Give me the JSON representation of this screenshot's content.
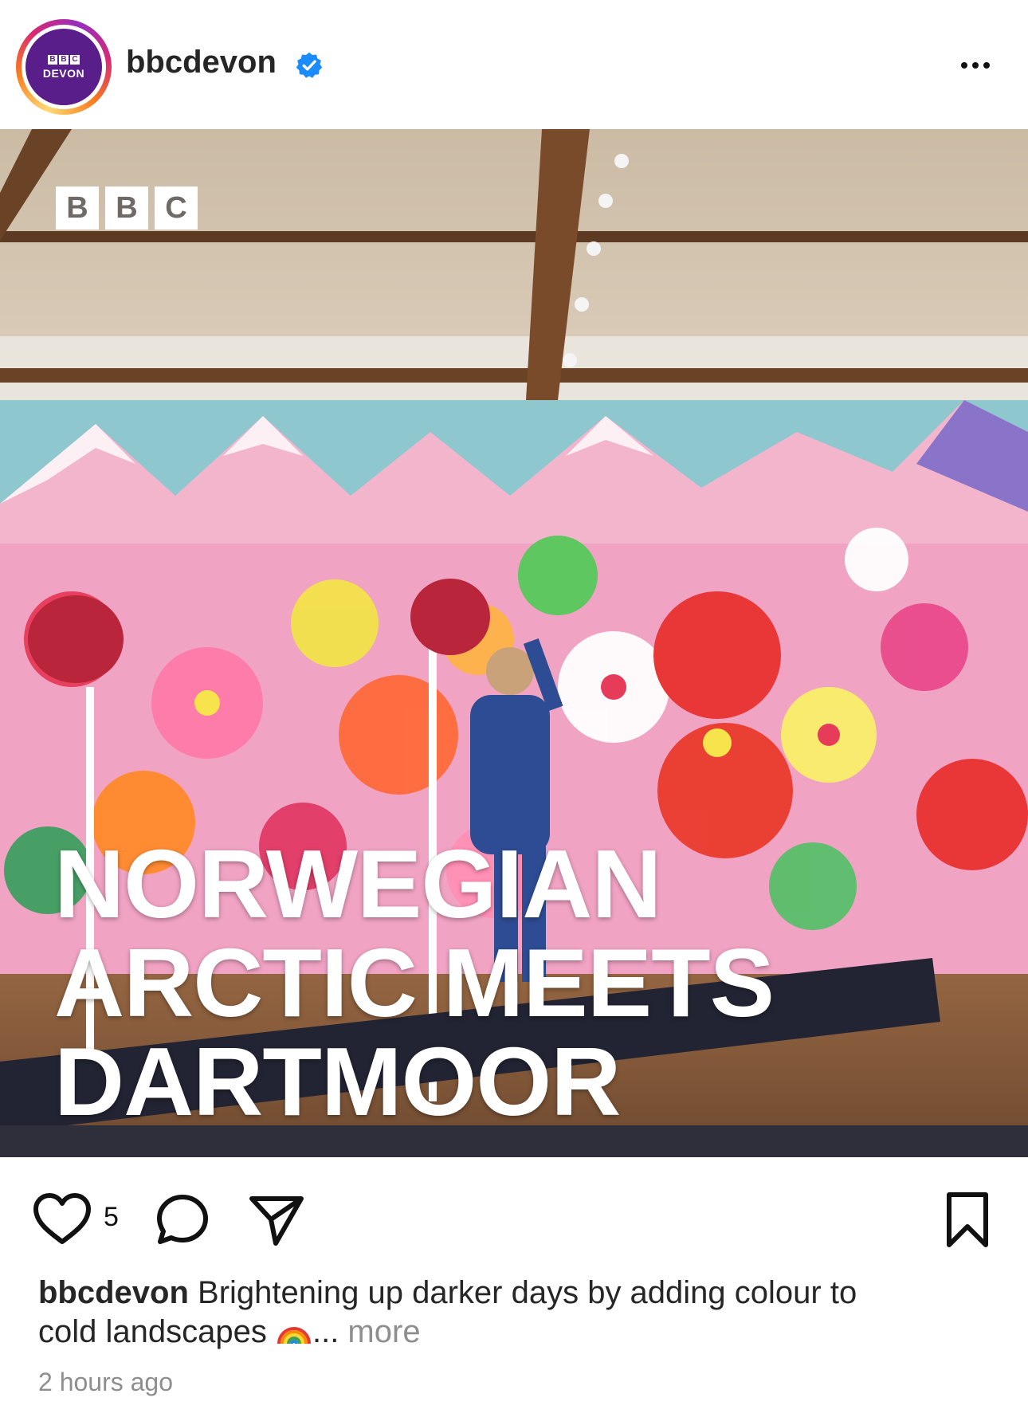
{
  "header": {
    "avatar_label": "DEVON",
    "avatar_bbc": [
      "B",
      "B",
      "C"
    ],
    "username": "bbcdevon",
    "verified": true
  },
  "post": {
    "logo_letters": [
      "B",
      "B",
      "C"
    ],
    "headline_lines": [
      "NORWEGIAN",
      "ARCTIC MEETS",
      "DARTMOOR"
    ]
  },
  "actions": {
    "like_count": "5"
  },
  "caption": {
    "username": "bbcdevon",
    "text_line1": " Brightening up darker days by adding colour to",
    "text_line2": "cold landscapes ",
    "ellipsis": "...",
    "more_label": " more",
    "emoji_icon": "rainbow-icon"
  },
  "timestamp": "2 hours ago",
  "colors": {
    "avatar_bg": "#5a1e8a",
    "verified_blue": "#1a8cff",
    "muted_text": "#8e8e8e"
  }
}
